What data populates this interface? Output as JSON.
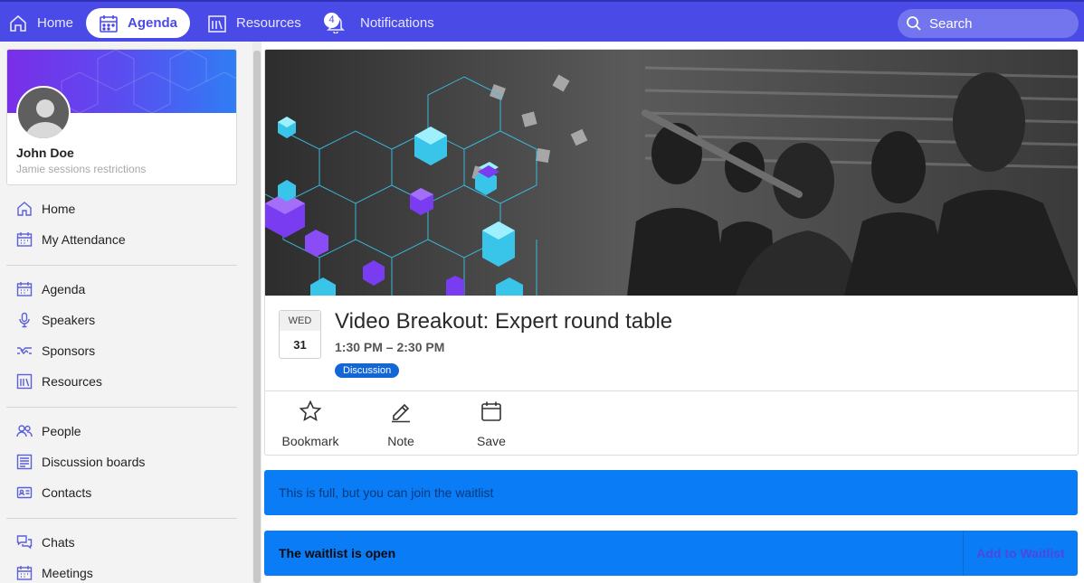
{
  "topnav": {
    "home": "Home",
    "agenda": "Agenda",
    "resources": "Resources",
    "notifications": "Notifications",
    "notification_count": "4",
    "search_placeholder": "Search"
  },
  "profile": {
    "name": "John Doe",
    "subtitle": "Jamie sessions restrictions"
  },
  "sidebar": {
    "items": [
      {
        "label": "Home",
        "icon": "home-icon"
      },
      {
        "label": "My Attendance",
        "icon": "calendar-icon"
      },
      {
        "label": "Agenda",
        "icon": "calendar-icon"
      },
      {
        "label": "Speakers",
        "icon": "microphone-icon"
      },
      {
        "label": "Sponsors",
        "icon": "handshake-icon"
      },
      {
        "label": "Resources",
        "icon": "library-icon"
      },
      {
        "label": "People",
        "icon": "people-icon"
      },
      {
        "label": "Discussion boards",
        "icon": "board-icon"
      },
      {
        "label": "Contacts",
        "icon": "contact-card-icon"
      },
      {
        "label": "Chats",
        "icon": "chat-icon"
      },
      {
        "label": "Meetings",
        "icon": "calendar-icon"
      }
    ]
  },
  "session": {
    "dow": "WED",
    "day": "31",
    "title": "Video Breakout: Expert round table",
    "time": "1:30 PM – 2:30 PM",
    "tag": "Discussion"
  },
  "actions": {
    "bookmark": "Bookmark",
    "note": "Note",
    "save": "Save"
  },
  "waitlist": {
    "full_message": "This is full, but you can join the waitlist",
    "open_message": "The waitlist is open",
    "add_button": "Add to Waitlist"
  },
  "colors": {
    "nav_bg": "#4a4be6",
    "banner_bg": "#0a7cf5",
    "tag_bg": "#1366d6"
  }
}
